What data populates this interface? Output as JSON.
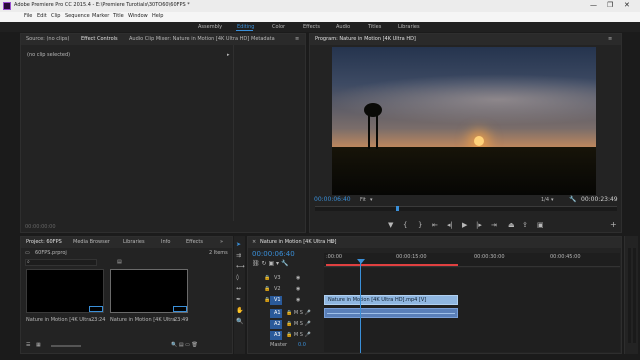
{
  "app": {
    "title": "Adobe Premiere Pro CC 2015.4 - E:\\Premiere Turotials\\30TO60\\60FPS *",
    "window_controls": [
      "—",
      "❐",
      "✕"
    ]
  },
  "menu": [
    "File",
    "Edit",
    "Clip",
    "Sequence",
    "Marker",
    "Title",
    "Window",
    "Help"
  ],
  "workspaces": [
    "Assembly",
    "Editing",
    "Color",
    "Effects",
    "Audio",
    "Titles",
    "Libraries"
  ],
  "workspace_active": "Editing",
  "source_panel": {
    "tabs": [
      "Source: (no clips)",
      "Effect Controls",
      "Audio Clip Mixer: Nature in Motion [4K Ultra HD]",
      "Metadata"
    ],
    "active_tab": "Effect Controls",
    "content": "(no clip selected)",
    "timecode": "00:00:00:00"
  },
  "program": {
    "title": "Program: Nature in Motion [4K Ultra HD]",
    "timecode": "00:00:06:40",
    "fit": "Fit",
    "ratio": "1/4",
    "duration": "00:00:23:49",
    "colors": {
      "sky_top": "#2b3a55",
      "sun": "#ffb347",
      "ground": "#0c0d08"
    }
  },
  "project": {
    "tabs": [
      "Project: 60FPS",
      "Media Browser",
      "Libraries",
      "Info",
      "Effects"
    ],
    "active_tab": "Project: 60FPS",
    "file": "60FPS.prproj",
    "items_count": "2 Items",
    "clips": [
      {
        "name": "Nature in Motion [4K Ultra...",
        "duration": "23:24"
      },
      {
        "name": "Nature in Motion [4K Ultra...",
        "duration": "23:49"
      }
    ]
  },
  "timeline": {
    "title": "Nature in Motion [4K Ultra HD]",
    "timecode": "00:00:06:40",
    "ruler": [
      ":00:00",
      "00:00:15:00",
      "00:00:30:00",
      "00:00:45:00"
    ],
    "video_tracks": [
      "V3",
      "V2",
      "V1"
    ],
    "audio_tracks": [
      "A1",
      "A2",
      "A3"
    ],
    "master": "Master",
    "master_value": "0.0",
    "clip_label": "Nature in Motion [4K Ultra HD].mp4 [V]",
    "colors": {
      "video_clip": "#8fb6e0",
      "audio_clip": "#5a7fb8",
      "playhead": "#3a8fd8"
    }
  }
}
